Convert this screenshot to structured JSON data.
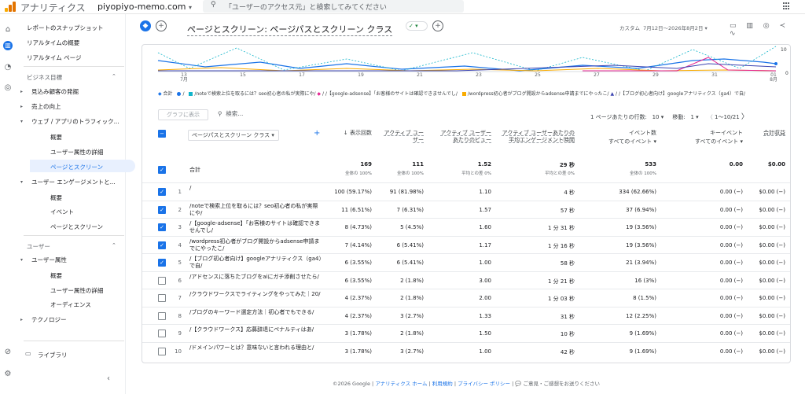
{
  "topbar": {
    "app_name": "アナリティクス",
    "property": "piyopiyo-memo.com",
    "property_caret": "▾",
    "search_placeholder": "「ユーザーのアクセス元」と検索してみてください"
  },
  "nav": {
    "items": [
      {
        "label": "レポートのスナップショット"
      },
      {
        "label": "リアルタイムの概要"
      },
      {
        "label": "リアルタイム ページ"
      }
    ],
    "business_goals": "ビジネス目標",
    "goal_items": [
      "見込み顧客の発掘",
      "売上の向上",
      "ウェブ / アプリのトラフィック..."
    ],
    "traffic_sub": [
      "概要",
      "ユーザー属性の詳細",
      "ページとスクリーン"
    ],
    "engagement": "ユーザー エンゲージメントと...",
    "engagement_sub": [
      "概要",
      "イベント",
      "ページとスクリーン"
    ],
    "user_group": "ユーザー",
    "user_attr": "ユーザー属性",
    "user_attr_sub": [
      "概要",
      "ユーザー属性の詳細",
      "オーディエンス"
    ],
    "technology": "テクノロジー",
    "library": "ライブラリ"
  },
  "header": {
    "title": "ページとスクリーン: ページパスとスクリーン クラス",
    "badge": "✓ ▾",
    "custom_label": "カスタム",
    "date_range": "7月12日〜2026年8月2日"
  },
  "chart_data": {
    "type": "line",
    "x_ticks": [
      {
        "day": "13",
        "month": "7月"
      },
      {
        "day": "15",
        "month": ""
      },
      {
        "day": "17",
        "month": ""
      },
      {
        "day": "19",
        "month": ""
      },
      {
        "day": "21",
        "month": ""
      },
      {
        "day": "23",
        "month": ""
      },
      {
        "day": "25",
        "month": ""
      },
      {
        "day": "27",
        "month": ""
      },
      {
        "day": "29",
        "month": ""
      },
      {
        "day": "31",
        "month": ""
      },
      {
        "day": "01",
        "month": "8月"
      }
    ],
    "right_axis": [
      "10",
      "0"
    ],
    "series": [
      {
        "name": "合計",
        "color": "#1a73e8"
      },
      {
        "name": "/noteで検索上位を取るには？seo初心者の私が実際にや/",
        "color": "#12b5cb"
      },
      {
        "name": "/【google-adsense】「お客様のサイトは確認できませんでし/",
        "color": "#e52592"
      },
      {
        "name": "/wordpress初心者がブログ開設からadsense申請までにやったこ/",
        "color": "#f9ab00"
      },
      {
        "name": "/【ブログ初心者向け】googleアナリティクス（ga4）で自/",
        "color": "#3c44b1"
      }
    ]
  },
  "toolbar": {
    "graph_button": "グラフに表示",
    "search_placeholder": "検索...",
    "rows_per_page_label": "1 ページあたりの行数:",
    "rows_per_page": "10",
    "goto_label": "移動:",
    "goto_value": "1",
    "pagination": "1〜10/21"
  },
  "table": {
    "dim_header": "ページパスとスクリーン クラス",
    "columns": [
      {
        "label": "↓ 表示回数",
        "sub": ""
      },
      {
        "label": "アクティブ ユーザー",
        "sub": ""
      },
      {
        "label": "アクティブ ユーザーあたりのビュー",
        "sub": ""
      },
      {
        "label": "アクティブ ユーザーあたりの平均エンゲージメント時間",
        "sub": ""
      },
      {
        "label": "イベント数",
        "sub": "すべてのイベント ▾"
      },
      {
        "label": "キーイベント",
        "sub": "すべてのイベント ▾"
      },
      {
        "label": "合計収益",
        "sub": ""
      }
    ],
    "total_label": "合計",
    "totals": [
      "169",
      "111",
      "1.52",
      "29 秒",
      "533",
      "0.00",
      "$0.00"
    ],
    "total_subs": [
      "全体の 100%",
      "全体の 100%",
      "平均との差 0%",
      "平均との差 0%",
      "全体の 100%",
      "",
      ""
    ],
    "rows": [
      {
        "n": "1",
        "page": "/",
        "checked": true,
        "vals": [
          "100 (59.17%)",
          "91 (81.98%)",
          "1.10",
          "4 秒",
          "334 (62.66%)",
          "0.00 (−)",
          "$0.00 (−)"
        ]
      },
      {
        "n": "2",
        "page": "/noteで検索上位を取るには？seo初心者の私が実際にや/",
        "checked": true,
        "vals": [
          "11 (6.51%)",
          "7 (6.31%)",
          "1.57",
          "57 秒",
          "37 (6.94%)",
          "0.00 (−)",
          "$0.00 (−)"
        ]
      },
      {
        "n": "3",
        "page": "/【google-adsense】「お客様のサイトは確認できませんでし/",
        "checked": true,
        "vals": [
          "8 (4.73%)",
          "5 (4.5%)",
          "1.60",
          "1 分 31 秒",
          "19 (3.56%)",
          "0.00 (−)",
          "$0.00 (−)"
        ]
      },
      {
        "n": "4",
        "page": "/wordpress初心者がブログ開設からadsense申請までにやったこ/",
        "checked": true,
        "vals": [
          "7 (4.14%)",
          "6 (5.41%)",
          "1.17",
          "1 分 16 秒",
          "19 (3.56%)",
          "0.00 (−)",
          "$0.00 (−)"
        ]
      },
      {
        "n": "5",
        "page": "/【ブログ初心者向け】googleアナリティクス（ga4）で自/",
        "checked": true,
        "vals": [
          "6 (3.55%)",
          "6 (5.41%)",
          "1.00",
          "58 秒",
          "21 (3.94%)",
          "0.00 (−)",
          "$0.00 (−)"
        ]
      },
      {
        "n": "6",
        "page": "/アドセンスに落ちたブログをaiにガチ添削させたら/",
        "checked": false,
        "vals": [
          "6 (3.55%)",
          "2 (1.8%)",
          "3.00",
          "1 分 21 秒",
          "16 (3%)",
          "0.00 (−)",
          "$0.00 (−)"
        ]
      },
      {
        "n": "7",
        "page": "/クラウドワークスでライティングをやってみた｜20/",
        "checked": false,
        "vals": [
          "4 (2.37%)",
          "2 (1.8%)",
          "2.00",
          "1 分 03 秒",
          "8 (1.5%)",
          "0.00 (−)",
          "$0.00 (−)"
        ]
      },
      {
        "n": "8",
        "page": "/ブログのキーワード選定方法｜初心者でもできる/",
        "checked": false,
        "vals": [
          "4 (2.37%)",
          "3 (2.7%)",
          "1.33",
          "31 秒",
          "12 (2.25%)",
          "0.00 (−)",
          "$0.00 (−)"
        ]
      },
      {
        "n": "9",
        "page": "/【クラウドワークス】応募辞退にペナルティはあ/",
        "checked": false,
        "vals": [
          "3 (1.78%)",
          "2 (1.8%)",
          "1.50",
          "10 秒",
          "9 (1.69%)",
          "0.00 (−)",
          "$0.00 (−)"
        ]
      },
      {
        "n": "10",
        "page": "/ドメインパワーとは？意味ないと言われる理由と/",
        "checked": false,
        "vals": [
          "3 (1.78%)",
          "3 (2.7%)",
          "1.00",
          "42 秒",
          "9 (1.69%)",
          "0.00 (−)",
          "$0.00 (−)"
        ]
      }
    ]
  },
  "footer": {
    "copyright": "©2026 Google |",
    "links": [
      "アナリティクス ホーム",
      "利用規約",
      "プライバシー ポリシー"
    ],
    "feedback": "| 💬 ご意見・ご感想をお送りください"
  },
  "colors": {
    "accent": "#1a73e8",
    "active_bg": "#e8f0fe"
  }
}
